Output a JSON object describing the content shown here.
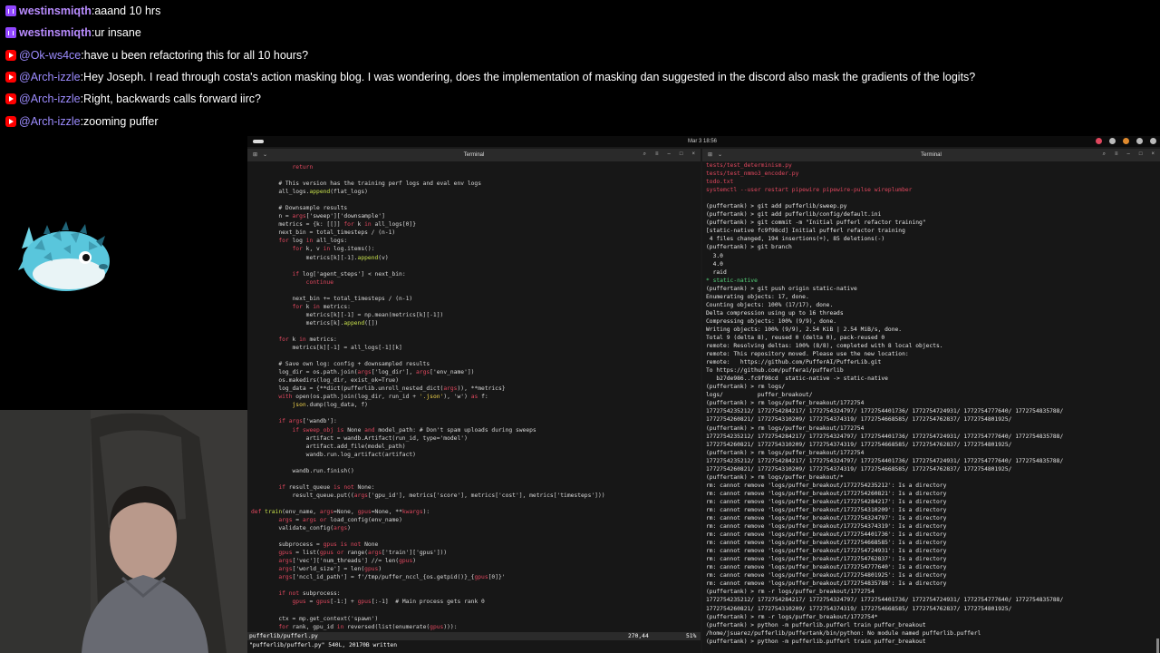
{
  "chat": [
    {
      "platform": "twitch",
      "user": "westinsmiqth",
      "message": "aaand 10 hrs"
    },
    {
      "platform": "twitch",
      "user": "westinsmiqth",
      "message": "ur insane"
    },
    {
      "platform": "youtube",
      "user": "@Ok-ws4ce",
      "message": "have u been refactoring this for all 10 hours?"
    },
    {
      "platform": "youtube",
      "user": "@Arch-izzle",
      "message": "Hey Joseph. I read through costa's action masking blog. I was wondering, does the implementation of masking dan suggested in the discord also mask the gradients of the logits?"
    },
    {
      "platform": "youtube",
      "user": "@Arch-izzle",
      "message": "Right, backwards calls forward iirc?"
    },
    {
      "platform": "youtube",
      "user": "@Arch-izzle",
      "message": "zooming puffer"
    }
  ],
  "topbar": {
    "clock": "Mar 3 18:56"
  },
  "left_terminal": {
    "title": "Terminal",
    "status_file": "pufferlib/pufferl.py",
    "status_pos": "270,44",
    "status_pct": "51%",
    "cmdline": "\"pufferlib/pufferl.py\" 540L, 20170B written"
  },
  "right_terminal": {
    "title": "Terminal",
    "lines": [
      "tests/test_determinism.py",
      "tests/test_nmmo3_encoder.py",
      "todo.txt",
      "systemctl --user restart pipewire pipewire-pulse wireplumber",
      "",
      "(puffertank) > git add pufferlib/sweep.py",
      "(puffertank) > git add pufferlib/config/default.ini",
      "(puffertank) > git commit -m \"Initial pufferl refactor training\"",
      "[static-native fc9f98cd] Initial pufferl refactor training",
      " 4 files changed, 194 insertions(+), 85 deletions(-)",
      "(puffertank) > git branch",
      "  3.0",
      "  4.0",
      "  raid",
      "* static-native",
      "(puffertank) > git push origin static-native",
      "Enumerating objects: 17, done.",
      "Counting objects: 100% (17/17), done.",
      "Delta compression using up to 16 threads",
      "Compressing objects: 100% (9/9), done.",
      "Writing objects: 100% (9/9), 2.54 KiB | 2.54 MiB/s, done.",
      "Total 9 (delta 8), reused 0 (delta 0), pack-reused 0",
      "remote: Resolving deltas: 100% (8/8), completed with 8 local objects.",
      "remote: This repository moved. Please use the new location:",
      "remote:   https://github.com/PufferAI/PufferLib.git",
      "To https://github.com/pufferai/pufferlib",
      "   b27de986..fc9f98cd  static-native -> static-native",
      "(puffertank) > rm logs/",
      "logs/          puffer_breakout/",
      "(puffertank) > rm logs/puffer_breakout/1772754",
      "1772754235212/ 1772754284217/ 1772754324797/ 1772754401736/ 1772754724931/ 1772754777640/ 1772754835788/",
      "1772754260821/ 1772754310209/ 1772754374319/ 1772754668585/ 1772754762837/ 1772754801925/",
      "(puffertank) > rm logs/puffer_breakout/1772754",
      "1772754235212/ 1772754284217/ 1772754324797/ 1772754401736/ 1772754724931/ 1772754777640/ 1772754835788/",
      "1772754260821/ 1772754310209/ 1772754374319/ 1772754668585/ 1772754762837/ 1772754801925/",
      "(puffertank) > rm logs/puffer_breakout/1772754",
      "1772754235212/ 1772754284217/ 1772754324797/ 1772754401736/ 1772754724931/ 1772754777640/ 1772754835788/",
      "1772754260821/ 1772754310209/ 1772754374319/ 1772754668585/ 1772754762837/ 1772754801925/",
      "(puffertank) > rm logs/puffer_breakout/*",
      "rm: cannot remove 'logs/puffer_breakout/1772754235212': Is a directory",
      "rm: cannot remove 'logs/puffer_breakout/1772754260821': Is a directory",
      "rm: cannot remove 'logs/puffer_breakout/1772754284217': Is a directory",
      "rm: cannot remove 'logs/puffer_breakout/1772754310209': Is a directory",
      "rm: cannot remove 'logs/puffer_breakout/1772754324797': Is a directory",
      "rm: cannot remove 'logs/puffer_breakout/1772754374319': Is a directory",
      "rm: cannot remove 'logs/puffer_breakout/1772754401736': Is a directory",
      "rm: cannot remove 'logs/puffer_breakout/1772754668585': Is a directory",
      "rm: cannot remove 'logs/puffer_breakout/1772754724931': Is a directory",
      "rm: cannot remove 'logs/puffer_breakout/1772754762837': Is a directory",
      "rm: cannot remove 'logs/puffer_breakout/1772754777640': Is a directory",
      "rm: cannot remove 'logs/puffer_breakout/1772754801925': Is a directory",
      "rm: cannot remove 'logs/puffer_breakout/1772754835788': Is a directory",
      "(puffertank) > rm -r logs/puffer_breakout/1772754",
      "1772754235212/ 1772754284217/ 1772754324797/ 1772754401736/ 1772754724931/ 1772754777640/ 1772754835788/",
      "1772754260821/ 1772754310209/ 1772754374319/ 1772754668585/ 1772754762837/ 1772754801925/",
      "(puffertank) > rm -r logs/puffer_breakout/1772754*",
      "(puffertank) > python -m pufferlib.pufferl train puffer_breakout",
      "/home/jsuarez/pufferlib/puffertank/bin/python: No module named pufferlib.pufferl",
      "(puffertank) > python -m pufferlib.pufferl train puffer_breakout"
    ]
  }
}
